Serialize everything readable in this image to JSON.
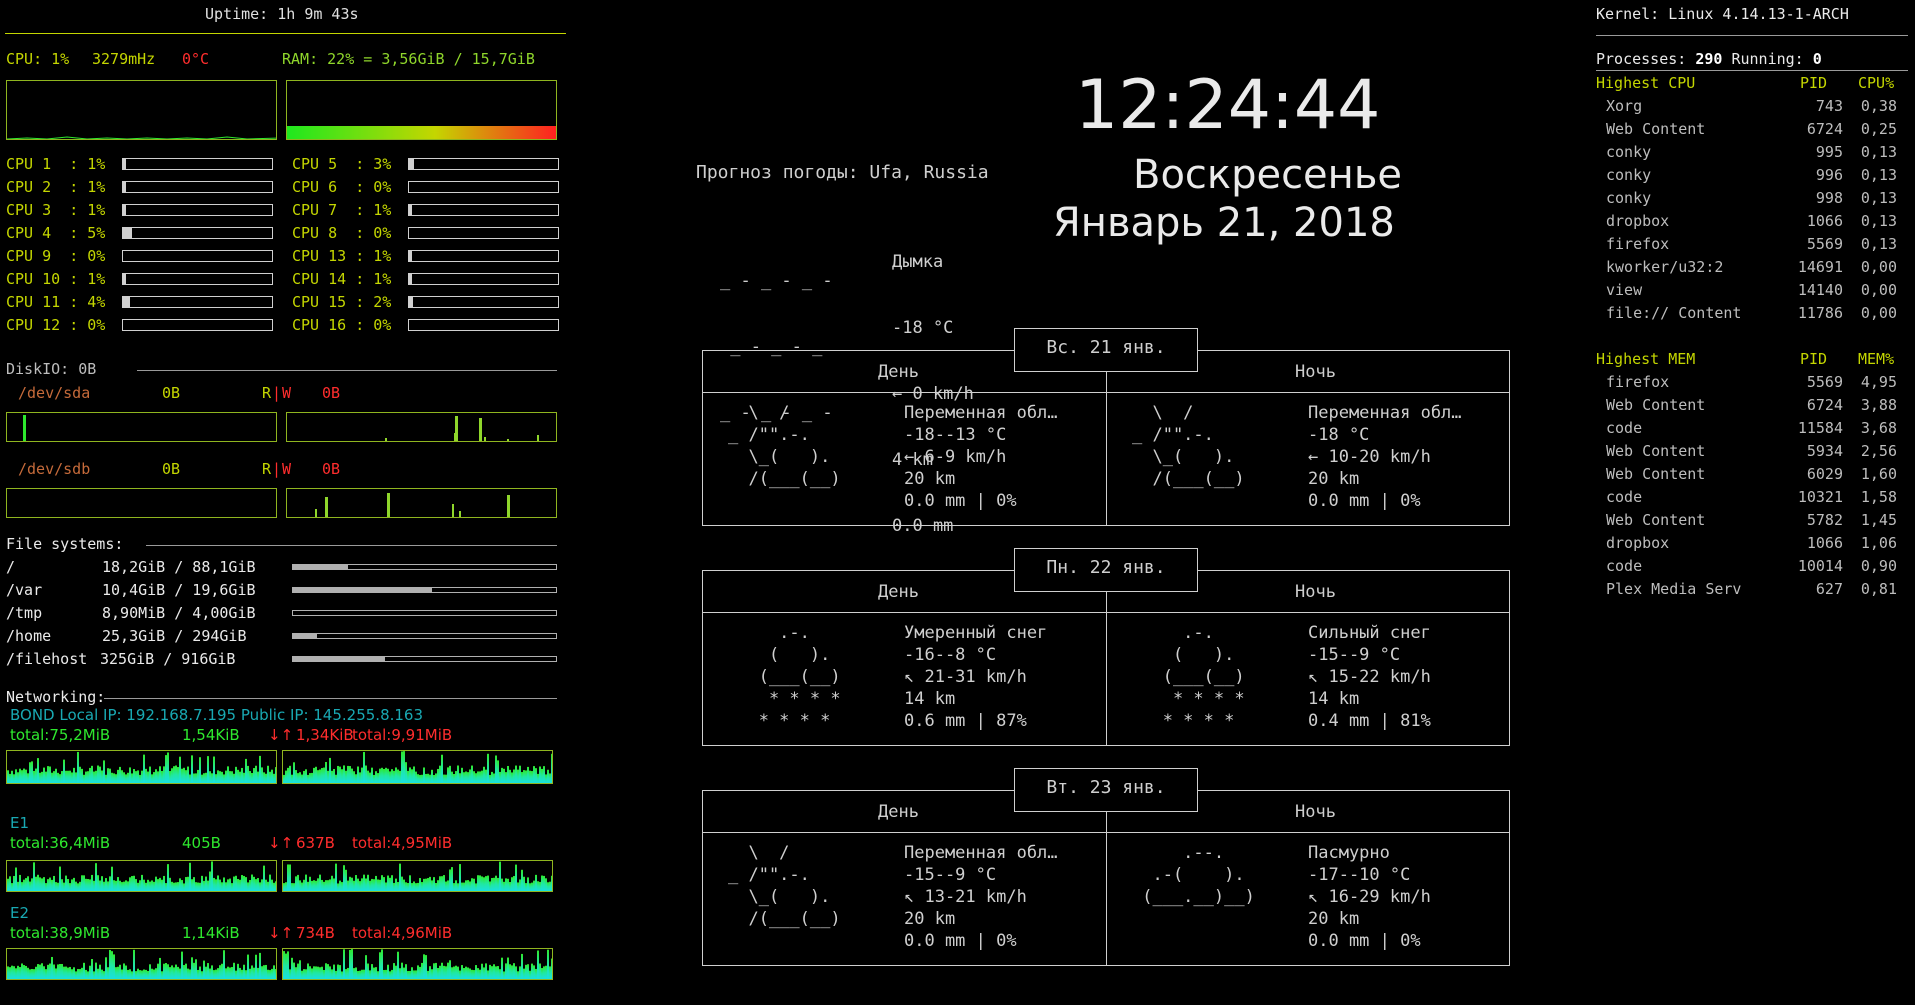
{
  "header": {
    "uptime": "Uptime: 1h 9m 43s",
    "kernel": "Kernel: Linux 4.14.13-1-ARCH"
  },
  "cpu": {
    "cpu_label": "CPU: 1%",
    "freq": "3279mHz",
    "temp": "0°C",
    "ram": "RAM: 22% = 3,56GiB / 15,7GiB",
    "ram_percent": 22,
    "cores": [
      {
        "label": "CPU 1  : 1%",
        "value": 1
      },
      {
        "label": "CPU 2  : 1%",
        "value": 1
      },
      {
        "label": "CPU 3  : 1%",
        "value": 1
      },
      {
        "label": "CPU 4  : 5%",
        "value": 5
      },
      {
        "label": "CPU 9  : 0%",
        "value": 0
      },
      {
        "label": "CPU 10 : 1%",
        "value": 1
      },
      {
        "label": "CPU 11 : 4%",
        "value": 4
      },
      {
        "label": "CPU 12 : 0%",
        "value": 0
      },
      {
        "label": "CPU 5  : 3%",
        "value": 3
      },
      {
        "label": "CPU 6  : 0%",
        "value": 0
      },
      {
        "label": "CPU 7  : 1%",
        "value": 1
      },
      {
        "label": "CPU 8  : 0%",
        "value": 0
      },
      {
        "label": "CPU 13 : 1%",
        "value": 1
      },
      {
        "label": "CPU 14 : 1%",
        "value": 1
      },
      {
        "label": "CPU 15 : 2%",
        "value": 2
      },
      {
        "label": "CPU 16 : 0%",
        "value": 0
      }
    ]
  },
  "disk": {
    "title": "DiskIO: 0B",
    "sda": {
      "name": "/dev/sda",
      "read": "0B",
      "r": "R",
      "sep": "|",
      "w": "W",
      "write": "0B"
    },
    "sdb": {
      "name": "/dev/sdb",
      "read": "0B",
      "r": "R",
      "sep": "|",
      "w": "W",
      "write": "0B"
    }
  },
  "filesystems": {
    "title": "File systems:",
    "items": [
      {
        "mount": "/",
        "usage": "18,2GiB / 88,1GiB",
        "fraction": 0.21
      },
      {
        "mount": "/var",
        "usage": "10,4GiB / 19,6GiB",
        "fraction": 0.53
      },
      {
        "mount": "/tmp",
        "usage": "8,90MiB / 4,00GiB",
        "fraction": 0.0
      },
      {
        "mount": "/home",
        "usage": "25,3GiB / 294GiB",
        "fraction": 0.09
      },
      {
        "mount": "/filehost",
        "usage": "325GiB / 916GiB",
        "fraction": 0.35
      }
    ]
  },
  "network": {
    "title": "Networking:",
    "bond": {
      "info": "BOND Local IP: 192.168.7.195 Public IP: 145.255.8.163",
      "total_down": "total:75,2MiB",
      "down": "1,54KiB",
      "arrows": "↓↑",
      "up": "1,34KiB",
      "total_up": "total:9,91MiB"
    },
    "e1": {
      "name": "E1",
      "total_down": "total:36,4MiB",
      "down": "405B",
      "arrows": "↓↑",
      "up": "637B",
      "total_up": "total:4,95MiB"
    },
    "e2": {
      "name": "E2",
      "total_down": "total:38,9MiB",
      "down": "1,14KiB",
      "arrows": "↓↑",
      "up": "734B",
      "total_up": "total:4,96MiB"
    }
  },
  "clock": {
    "time": "12:24:44",
    "weekday": "Воскресенье",
    "date": "Январь 21, 2018"
  },
  "weather": {
    "title": "Прогноз погоды: Ufa, Russia",
    "current": {
      "art": [
        "_ - _ - _ -",
        " _ - _ - _",
        "_ - _ - _ -"
      ],
      "lines": [
        "Дымка",
        "-18 °C",
        "← 0 km/h",
        "4 km",
        "0.0 mm"
      ]
    },
    "days": [
      {
        "date": "Вс. 21 янв.",
        "day_label": "День",
        "night_label": "Ночь",
        "day_art": [
          "  \\  /",
          "_ /\"\".-.",
          "  \\_(   ).",
          "  /(___(__)"
        ],
        "day_lines": [
          "Переменная обл…",
          "-18--13 °C",
          "← 6-9 km/h",
          "20 km",
          "0.0 mm | 0%"
        ],
        "night_art": [
          "  \\  /",
          "_ /\"\".-.",
          "  \\_(   ).",
          "  /(___(__)"
        ],
        "night_lines": [
          "Переменная обл…",
          "-18 °C",
          "← 10-20 km/h",
          "20 km",
          "0.0 mm | 0%"
        ]
      },
      {
        "date": "Пн. 22 янв.",
        "day_label": "День",
        "night_label": "Ночь",
        "day_art": [
          "     .-.",
          "    (   ).",
          "   (___(__)",
          "    * * * *",
          "   * * * *"
        ],
        "day_lines": [
          "Умеренный снег",
          "-16--8 °C",
          "↖ 21-31 km/h",
          "14 km",
          "0.6 mm | 87%"
        ],
        "night_art": [
          "     .-.",
          "    (   ).",
          "   (___(__)",
          "    * * * *",
          "   * * * *"
        ],
        "night_lines": [
          "Сильный снег",
          "-15--9 °C",
          "↖ 15-22 km/h",
          "14 km",
          "0.4 mm | 81%"
        ]
      },
      {
        "date": "Вт. 23 янв.",
        "day_label": "День",
        "night_label": "Ночь",
        "day_art": [
          "  \\  /",
          "_ /\"\".-.",
          "  \\_(   ).",
          "  /(___(__)"
        ],
        "day_lines": [
          "Переменная обл…",
          "-15--9 °C",
          "↖ 13-21 km/h",
          "20 km",
          "0.0 mm | 0%"
        ],
        "night_art": [
          "",
          "     .--.",
          "  .-(    ).",
          " (___.__)__)"
        ],
        "night_lines": [
          "Пасмурно",
          "-17--10 °C",
          "↖ 16-29 km/h",
          "20 km",
          "0.0 mm | 0%"
        ]
      }
    ]
  },
  "processes": {
    "summary_label": "Processes: ",
    "summary_count": "290",
    "running_label": " Running: ",
    "running_count": "0",
    "cpu_header": {
      "name": "Highest CPU",
      "pid": "PID",
      "val": "CPU%"
    },
    "cpu_rows": [
      {
        "name": "Xorg",
        "pid": "743",
        "val": "0,38"
      },
      {
        "name": "Web Content",
        "pid": "6724",
        "val": "0,25"
      },
      {
        "name": "conky",
        "pid": "995",
        "val": "0,13"
      },
      {
        "name": "conky",
        "pid": "996",
        "val": "0,13"
      },
      {
        "name": "conky",
        "pid": "998",
        "val": "0,13"
      },
      {
        "name": "dropbox",
        "pid": "1066",
        "val": "0,13"
      },
      {
        "name": "firefox",
        "pid": "5569",
        "val": "0,13"
      },
      {
        "name": "kworker/u32:2",
        "pid": "14691",
        "val": "0,00"
      },
      {
        "name": "view",
        "pid": "14140",
        "val": "0,00"
      },
      {
        "name": "file:// Content",
        "pid": "11786",
        "val": "0,00"
      }
    ],
    "mem_header": {
      "name": "Highest MEM",
      "pid": "PID",
      "val": "MEM%"
    },
    "mem_rows": [
      {
        "name": "firefox",
        "pid": "5569",
        "val": "4,95"
      },
      {
        "name": "Web Content",
        "pid": "6724",
        "val": "3,88"
      },
      {
        "name": "code",
        "pid": "11584",
        "val": "3,68"
      },
      {
        "name": "Web Content",
        "pid": "5934",
        "val": "2,56"
      },
      {
        "name": "Web Content",
        "pid": "6029",
        "val": "1,60"
      },
      {
        "name": "code",
        "pid": "10321",
        "val": "1,58"
      },
      {
        "name": "Web Content",
        "pid": "5782",
        "val": "1,45"
      },
      {
        "name": "dropbox",
        "pid": "1066",
        "val": "1,06"
      },
      {
        "name": "code",
        "pid": "10014",
        "val": "0,90"
      },
      {
        "name": "Plex Media Serv",
        "pid": "627",
        "val": "0,81"
      }
    ]
  },
  "colors": {
    "accent_yellow": "#c4d600",
    "green": "#2ee82e",
    "red": "#ff2d2d",
    "teal": "#19a9b3",
    "graph_border": "#8fb51f"
  }
}
